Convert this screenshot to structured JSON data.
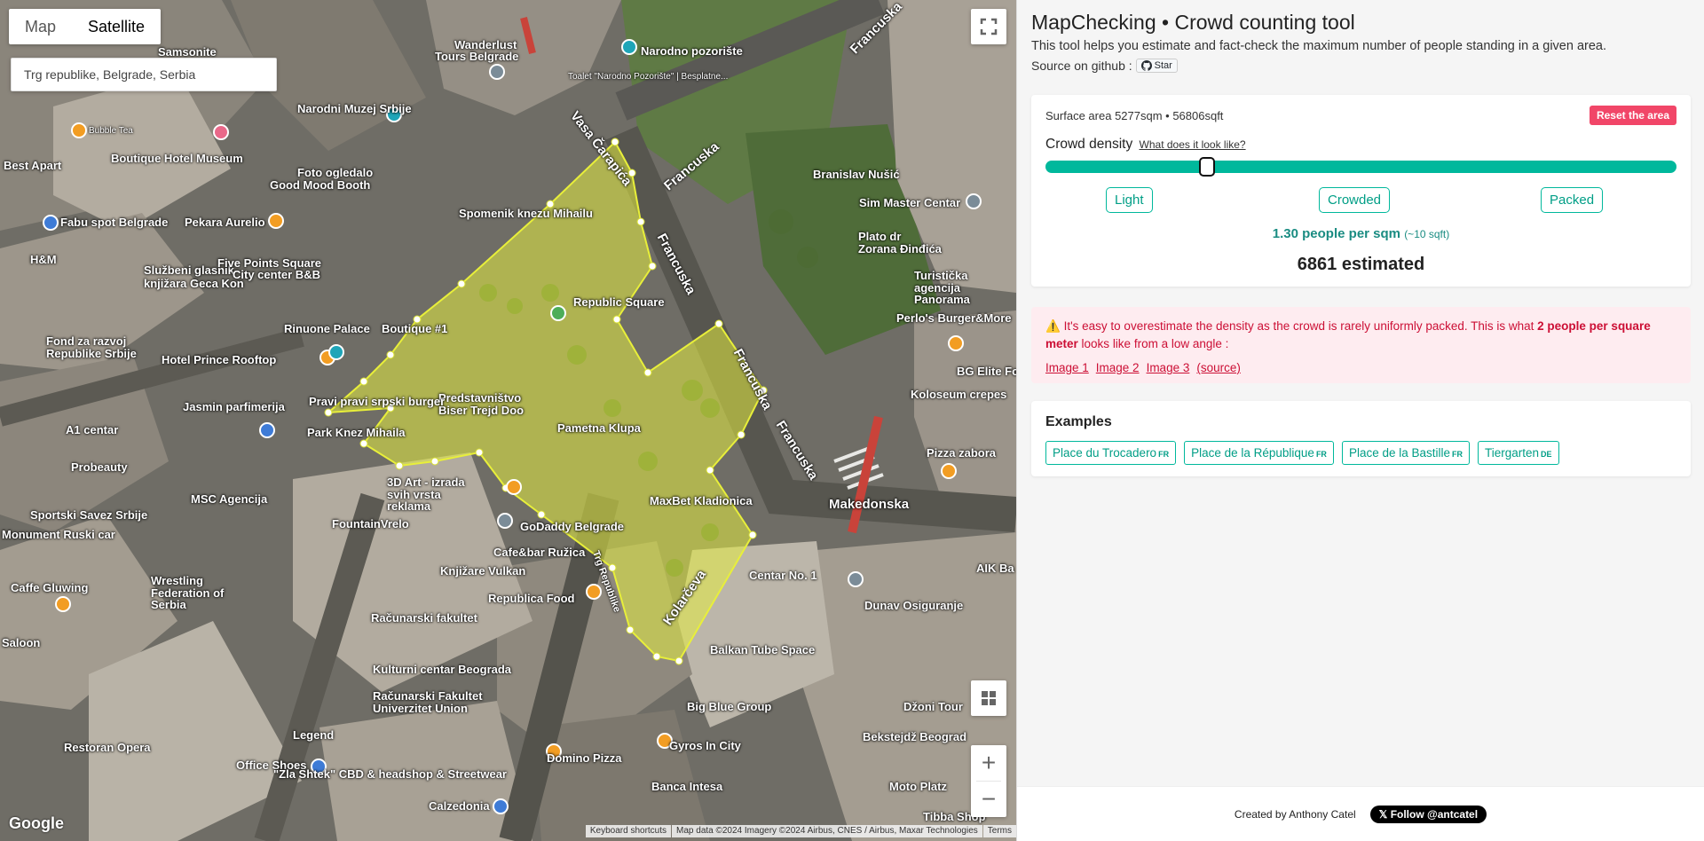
{
  "map": {
    "type_buttons": [
      "Map",
      "Satellite"
    ],
    "search_value": "Trg republike, Belgrade, Serbia",
    "labels": [
      {
        "text": "Samsonite",
        "small": false
      },
      {
        "text": "Wanderlust",
        "small": false
      },
      {
        "text": "Tours Belgrade",
        "small": false
      },
      {
        "text": "Narodno pozorište",
        "small": false
      },
      {
        "text": "Toalet \"Narodno Pozorište\" | Besplatne...",
        "small": false
      },
      {
        "text": "Narodni Muzej Srbije",
        "small": false
      },
      {
        "text": "Bubble Tea",
        "small": true
      },
      {
        "text": "Best Apart",
        "small": false
      },
      {
        "text": "Boutique Hotel Museum",
        "small": false
      },
      {
        "text": "Foto ogledalo",
        "small": false
      },
      {
        "text": "Good Mood Booth",
        "small": false
      },
      {
        "text": "Spomenik knezu Mihailu",
        "small": false
      },
      {
        "text": "Branislav Nušić",
        "small": false
      },
      {
        "text": "Sim Master Centar",
        "small": false
      },
      {
        "text": "Fabu spot Belgrade",
        "small": false
      },
      {
        "text": "Pekara Aurelio",
        "small": false
      },
      {
        "text": "H&M",
        "small": false
      },
      {
        "text": "Službeni glasnik",
        "small": false
      },
      {
        "text": "knjižara Geca Kon",
        "small": false
      },
      {
        "text": "Five Points Square",
        "small": false
      },
      {
        "text": "City center B&B",
        "small": false
      },
      {
        "text": "Republic Square",
        "small": false
      },
      {
        "text": "Plato dr Zorana Đinđića",
        "small": false
      },
      {
        "text": "Turistička agencija Panorama",
        "small": false
      },
      {
        "text": "Perlo's Burger&More",
        "small": false
      },
      {
        "text": "Rinuone Palace",
        "small": false
      },
      {
        "text": "Boutique #1",
        "small": false
      },
      {
        "text": "Fond za razvoj Republike Srbije",
        "small": false
      },
      {
        "text": "Hotel Prince Rooftop",
        "small": false
      },
      {
        "text": "Predstavništvo Biser Trejd Doo",
        "small": false
      },
      {
        "text": "Pravi pravi srpski burger",
        "small": false
      },
      {
        "text": "Jasmin parfimerija",
        "small": false
      },
      {
        "text": "Pametna Klupa",
        "small": false
      },
      {
        "text": "BG Elite Food",
        "small": false
      },
      {
        "text": "Koloseum crepes",
        "small": false
      },
      {
        "text": "A1 centar",
        "small": false
      },
      {
        "text": "Park Knez Mihaila",
        "small": false
      },
      {
        "text": "Probeauty",
        "small": false
      },
      {
        "text": "3D Art - izrada svih vrsta reklama",
        "small": false
      },
      {
        "text": "MSC Agencija",
        "small": false
      },
      {
        "text": "MaxBet Kladionica",
        "small": false
      },
      {
        "text": "Pizza zabora",
        "small": false
      },
      {
        "text": "Makedonska",
        "small": false
      },
      {
        "text": "Sportski Savez Srbije",
        "small": false
      },
      {
        "text": "FountainVrelo",
        "small": false
      },
      {
        "text": "GoDaddy Belgrade",
        "small": false
      },
      {
        "text": "Monument Ruski car",
        "small": false
      },
      {
        "text": "Cafe&bar Ružica",
        "small": false
      },
      {
        "text": "Knjižare Vulkan",
        "small": false
      },
      {
        "text": "Centar No. 1",
        "small": false
      },
      {
        "text": "Dunav Osiguranje",
        "small": false
      },
      {
        "text": "AIK Ba",
        "small": false
      },
      {
        "text": "Caffe Gluwing",
        "small": false
      },
      {
        "text": "Wrestling Federation of Serbia",
        "small": false
      },
      {
        "text": "Republica Food",
        "small": false
      },
      {
        "text": "Balkan Tube Space",
        "small": false
      },
      {
        "text": "Računarski fakultet",
        "small": false
      },
      {
        "text": "Kulturni centar Beograda",
        "small": false
      },
      {
        "text": "Računarski Fakultet Univerzitet Union",
        "small": false
      },
      {
        "text": "Big Blue Group",
        "small": false
      },
      {
        "text": "Džoni Tour",
        "small": false
      },
      {
        "text": "Bekstejdž Beograd",
        "small": false
      },
      {
        "text": "Restoran Opera",
        "small": false
      },
      {
        "text": "Legend",
        "small": false
      },
      {
        "text": "Office Shoes",
        "small": false
      },
      {
        "text": "Domino Pizza",
        "small": false
      },
      {
        "text": "Gyros In City",
        "small": false
      },
      {
        "text": "Moto Platz",
        "small": false
      },
      {
        "text": "Banca Intesa",
        "small": false
      },
      {
        "text": "\"Zla Shtek\" CBD & headshop & Streetwear",
        "small": false
      },
      {
        "text": "Calzedonia",
        "small": false
      },
      {
        "text": "Tibba Shop",
        "small": false
      },
      {
        "text": "Saloon",
        "small": false
      }
    ],
    "streets": [
      "Francuska",
      "Vasa Čarapića",
      "Kolarčeva",
      "Trg Republike",
      "Makedonska"
    ],
    "google": "Google",
    "attribution": [
      "Keyboard shortcuts",
      "Map data ©2024 Imagery ©2024 Airbus, CNES / Airbus, Maxar Technologies",
      "Terms"
    ]
  },
  "sidebar": {
    "title": "MapChecking • Crowd counting tool",
    "subtitle": "This tool helps you estimate and fact-check the maximum number of people standing in a given area.",
    "source_label": "Source on github :",
    "star_label": "Star",
    "surface_label": "Surface area",
    "surface_value": "5277sqm • 56806sqft",
    "reset_label": "Reset the area",
    "density_label": "Crowd density",
    "density_link": "What does it look like?",
    "density_level": 0.25,
    "chips": [
      "Light",
      "Crowded",
      "Packed"
    ],
    "people_per_sqm": "1.30 people per sqm",
    "people_per_sqft": "(~10 sqft)",
    "estimated": "6861 estimated",
    "warning_text_1": "It's easy to overestimate the density as the crowd is rarely uniformly packed. This is what",
    "warning_bold": "2 people per square meter",
    "warning_text_2": "looks like from a low angle :",
    "warning_links": [
      "Image 1",
      "Image 2",
      "Image 3"
    ],
    "warning_source": "(source)",
    "examples_title": "Examples",
    "examples": [
      {
        "label": "Place du Trocadero",
        "country": "FR"
      },
      {
        "label": "Place de la République",
        "country": "FR"
      },
      {
        "label": "Place de la Bastille",
        "country": "FR"
      },
      {
        "label": "Tiergarten",
        "country": "DE"
      }
    ],
    "footer_credit": "Created by Anthony Catel",
    "follow_label": "Follow @antcatel"
  },
  "colors": {
    "accent": "#00b89c",
    "danger": "#f14668",
    "polygon_fill": "#e4ec3f"
  }
}
